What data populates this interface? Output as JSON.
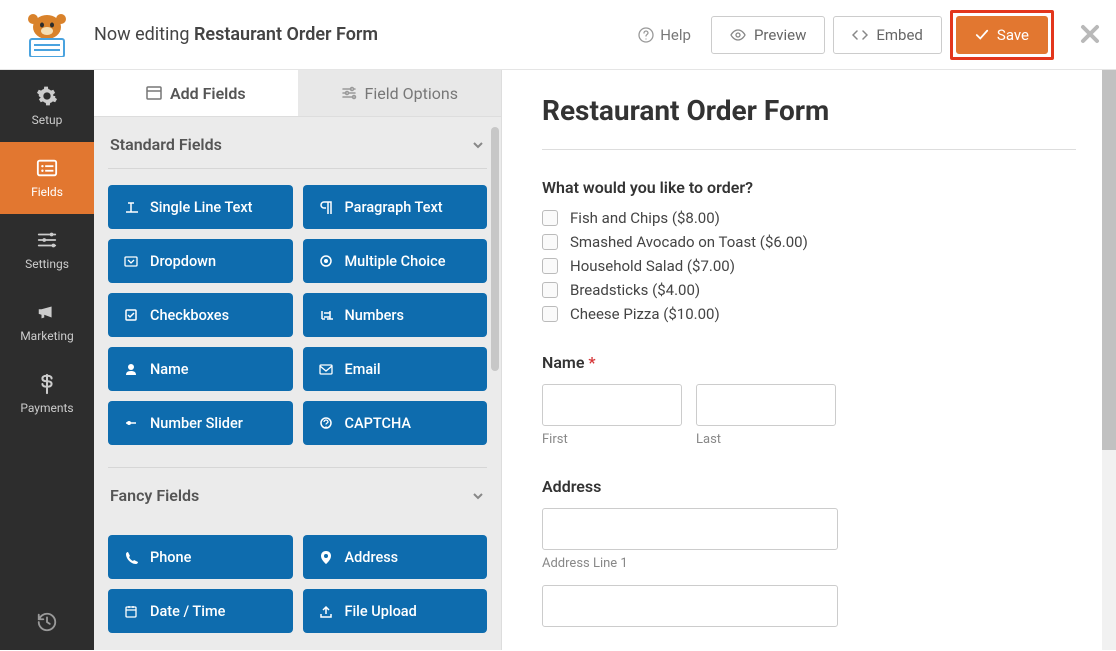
{
  "header": {
    "editing_prefix": "Now editing ",
    "form_name": "Restaurant Order Form",
    "help": "Help",
    "preview": "Preview",
    "embed": "Embed",
    "save": "Save"
  },
  "nav": {
    "setup": "Setup",
    "fields": "Fields",
    "settings": "Settings",
    "marketing": "Marketing",
    "payments": "Payments"
  },
  "tabs": {
    "add_fields": "Add Fields",
    "field_options": "Field Options"
  },
  "sections": {
    "standard": "Standard Fields",
    "fancy": "Fancy Fields"
  },
  "standard_fields": [
    "Single Line Text",
    "Paragraph Text",
    "Dropdown",
    "Multiple Choice",
    "Checkboxes",
    "Numbers",
    "Name",
    "Email",
    "Number Slider",
    "CAPTCHA"
  ],
  "fancy_fields": [
    "Phone",
    "Address",
    "Date / Time",
    "File Upload"
  ],
  "preview": {
    "title": "Restaurant Order Form",
    "q1": "What would you like to order?",
    "options": [
      "Fish and Chips ($8.00)",
      "Smashed Avocado on Toast ($6.00)",
      "Household Salad ($7.00)",
      "Breadsticks ($4.00)",
      "Cheese Pizza ($10.00)"
    ],
    "name_label": "Name",
    "first": "First",
    "last": "Last",
    "address_label": "Address",
    "address_line1": "Address Line 1"
  }
}
